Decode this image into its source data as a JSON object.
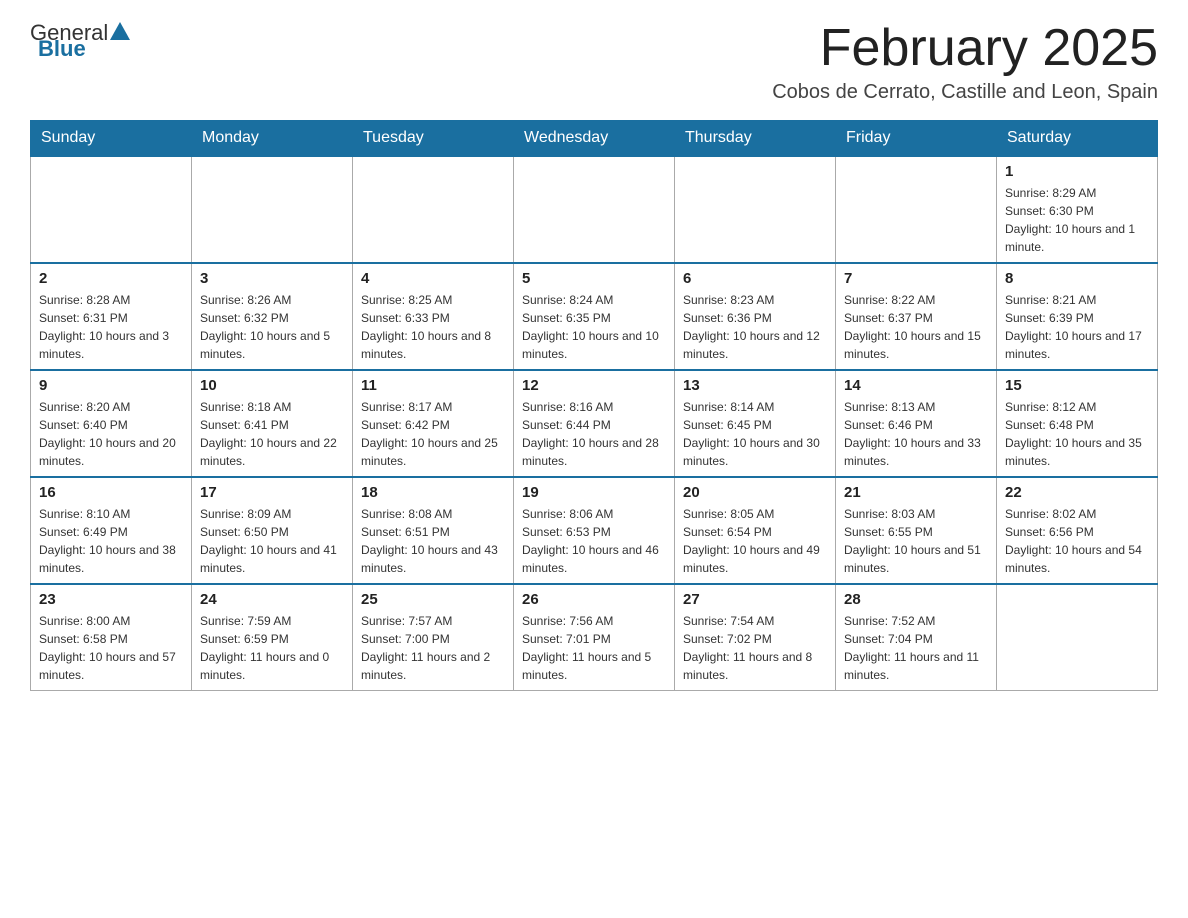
{
  "logo": {
    "general": "General",
    "blue": "Blue"
  },
  "title": "February 2025",
  "location": "Cobos de Cerrato, Castille and Leon, Spain",
  "days_of_week": [
    "Sunday",
    "Monday",
    "Tuesday",
    "Wednesday",
    "Thursday",
    "Friday",
    "Saturday"
  ],
  "weeks": [
    [
      {
        "day": "",
        "info": ""
      },
      {
        "day": "",
        "info": ""
      },
      {
        "day": "",
        "info": ""
      },
      {
        "day": "",
        "info": ""
      },
      {
        "day": "",
        "info": ""
      },
      {
        "day": "",
        "info": ""
      },
      {
        "day": "1",
        "info": "Sunrise: 8:29 AM\nSunset: 6:30 PM\nDaylight: 10 hours and 1 minute."
      }
    ],
    [
      {
        "day": "2",
        "info": "Sunrise: 8:28 AM\nSunset: 6:31 PM\nDaylight: 10 hours and 3 minutes."
      },
      {
        "day": "3",
        "info": "Sunrise: 8:26 AM\nSunset: 6:32 PM\nDaylight: 10 hours and 5 minutes."
      },
      {
        "day": "4",
        "info": "Sunrise: 8:25 AM\nSunset: 6:33 PM\nDaylight: 10 hours and 8 minutes."
      },
      {
        "day": "5",
        "info": "Sunrise: 8:24 AM\nSunset: 6:35 PM\nDaylight: 10 hours and 10 minutes."
      },
      {
        "day": "6",
        "info": "Sunrise: 8:23 AM\nSunset: 6:36 PM\nDaylight: 10 hours and 12 minutes."
      },
      {
        "day": "7",
        "info": "Sunrise: 8:22 AM\nSunset: 6:37 PM\nDaylight: 10 hours and 15 minutes."
      },
      {
        "day": "8",
        "info": "Sunrise: 8:21 AM\nSunset: 6:39 PM\nDaylight: 10 hours and 17 minutes."
      }
    ],
    [
      {
        "day": "9",
        "info": "Sunrise: 8:20 AM\nSunset: 6:40 PM\nDaylight: 10 hours and 20 minutes."
      },
      {
        "day": "10",
        "info": "Sunrise: 8:18 AM\nSunset: 6:41 PM\nDaylight: 10 hours and 22 minutes."
      },
      {
        "day": "11",
        "info": "Sunrise: 8:17 AM\nSunset: 6:42 PM\nDaylight: 10 hours and 25 minutes."
      },
      {
        "day": "12",
        "info": "Sunrise: 8:16 AM\nSunset: 6:44 PM\nDaylight: 10 hours and 28 minutes."
      },
      {
        "day": "13",
        "info": "Sunrise: 8:14 AM\nSunset: 6:45 PM\nDaylight: 10 hours and 30 minutes."
      },
      {
        "day": "14",
        "info": "Sunrise: 8:13 AM\nSunset: 6:46 PM\nDaylight: 10 hours and 33 minutes."
      },
      {
        "day": "15",
        "info": "Sunrise: 8:12 AM\nSunset: 6:48 PM\nDaylight: 10 hours and 35 minutes."
      }
    ],
    [
      {
        "day": "16",
        "info": "Sunrise: 8:10 AM\nSunset: 6:49 PM\nDaylight: 10 hours and 38 minutes."
      },
      {
        "day": "17",
        "info": "Sunrise: 8:09 AM\nSunset: 6:50 PM\nDaylight: 10 hours and 41 minutes."
      },
      {
        "day": "18",
        "info": "Sunrise: 8:08 AM\nSunset: 6:51 PM\nDaylight: 10 hours and 43 minutes."
      },
      {
        "day": "19",
        "info": "Sunrise: 8:06 AM\nSunset: 6:53 PM\nDaylight: 10 hours and 46 minutes."
      },
      {
        "day": "20",
        "info": "Sunrise: 8:05 AM\nSunset: 6:54 PM\nDaylight: 10 hours and 49 minutes."
      },
      {
        "day": "21",
        "info": "Sunrise: 8:03 AM\nSunset: 6:55 PM\nDaylight: 10 hours and 51 minutes."
      },
      {
        "day": "22",
        "info": "Sunrise: 8:02 AM\nSunset: 6:56 PM\nDaylight: 10 hours and 54 minutes."
      }
    ],
    [
      {
        "day": "23",
        "info": "Sunrise: 8:00 AM\nSunset: 6:58 PM\nDaylight: 10 hours and 57 minutes."
      },
      {
        "day": "24",
        "info": "Sunrise: 7:59 AM\nSunset: 6:59 PM\nDaylight: 11 hours and 0 minutes."
      },
      {
        "day": "25",
        "info": "Sunrise: 7:57 AM\nSunset: 7:00 PM\nDaylight: 11 hours and 2 minutes."
      },
      {
        "day": "26",
        "info": "Sunrise: 7:56 AM\nSunset: 7:01 PM\nDaylight: 11 hours and 5 minutes."
      },
      {
        "day": "27",
        "info": "Sunrise: 7:54 AM\nSunset: 7:02 PM\nDaylight: 11 hours and 8 minutes."
      },
      {
        "day": "28",
        "info": "Sunrise: 7:52 AM\nSunset: 7:04 PM\nDaylight: 11 hours and 11 minutes."
      },
      {
        "day": "",
        "info": ""
      }
    ]
  ]
}
